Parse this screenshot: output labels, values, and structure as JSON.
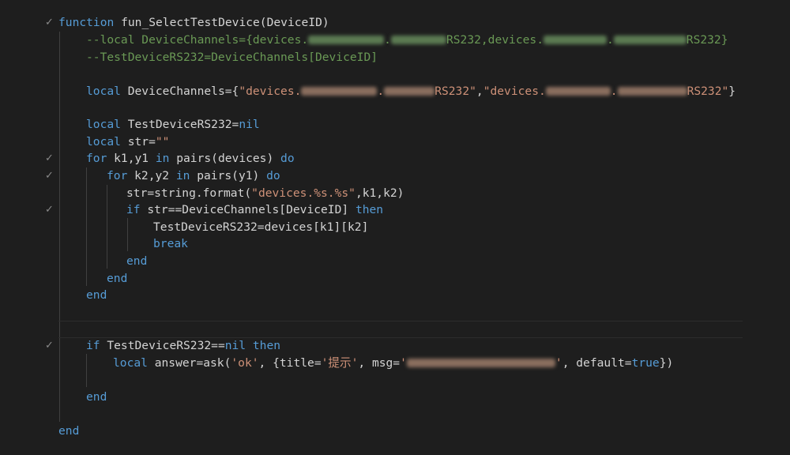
{
  "code": {
    "func_kw": "function",
    "func_sig": " fun_SelectTestDevice(DeviceID)",
    "l2_prefix": "--local DeviceChannels={devices.",
    "l2_mid1": ".",
    "l2_mid2": "RS232,devices.",
    "l2_mid3": ".",
    "l2_suffix": "RS232}",
    "l3": "--TestDeviceRS232=DeviceChannels[DeviceID]",
    "l5_kw": "local",
    "l5_var": " DeviceChannels={",
    "l5_s1a": "\"devices.",
    "l5_s1b": ".",
    "l5_s1c": "RS232\"",
    "l5_comma": ",",
    "l5_s2a": "\"devices.",
    "l5_s2b": ".",
    "l5_s2c": "RS232\"",
    "l5_close": "}",
    "l7_kw": "local",
    "l7_var": " TestDeviceRS232=",
    "l7_nil": "nil",
    "l8_kw": "local",
    "l8_var": " str=",
    "l8_str": "\"\"",
    "l9_for": "for",
    "l9_a": " k1,y1 ",
    "l9_in": "in",
    "l9_b": " pairs(devices) ",
    "l9_do": "do",
    "l10_for": "for",
    "l10_a": " k2,y2 ",
    "l10_in": "in",
    "l10_b": " pairs(y1) ",
    "l10_do": "do",
    "l11_a": "str=string.format(",
    "l11_str": "\"devices.%s.%s\"",
    "l11_b": ",k1,k2)",
    "l12_if": "if",
    "l12_a": " str==DeviceChannels[DeviceID] ",
    "l12_then": "then",
    "l13": "TestDeviceRS232=devices[k1][k2]",
    "l14_break": "break",
    "end": "end",
    "l19_if": "if",
    "l19_a": " TestDeviceRS232==",
    "l19_nil": "nil",
    "l19_then": "then",
    "l20_local": "local",
    "l20_a": " answer=ask(",
    "l20_ok": "'ok'",
    "l20_b": ", {title=",
    "l20_title": "'提示'",
    "l20_c": ", msg=",
    "l20_msg_open": "'",
    "l20_msg_close": "'",
    "l20_d": ", default=",
    "l20_true": "true",
    "l20_e": "})"
  },
  "gutter": {
    "fold_glyph": "✓"
  },
  "colors": {
    "background": "#1e1e1e",
    "keyword": "#569cd6",
    "comment": "#6a9955",
    "string": "#ce9178",
    "text": "#d4d4d4"
  }
}
